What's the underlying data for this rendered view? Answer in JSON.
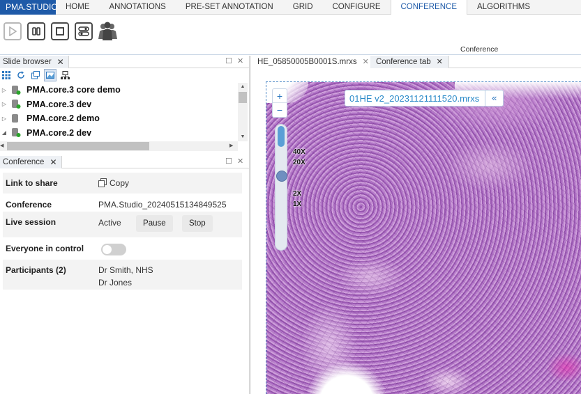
{
  "menu": {
    "brand": "PMA.STUDIO",
    "items": [
      "HOME",
      "ANNOTATIONS",
      "PRE-SET ANNOTATION",
      "GRID",
      "CONFIGURE",
      "CONFERENCE",
      "ALGORITHMS"
    ],
    "active": "CONFERENCE"
  },
  "ribbon": {
    "caption": "Conference",
    "buttons": [
      "play-icon",
      "pause-icon",
      "stop-icon",
      "toggle-settings-icon",
      "participants-icon"
    ]
  },
  "slide_browser": {
    "title": "Slide browser",
    "tools": [
      "grid-icon",
      "refresh-icon",
      "open-window-icon",
      "image-view-icon",
      "network-icon"
    ],
    "tree": [
      {
        "label": "PMA.core.3 core demo",
        "expanded": false,
        "status": "connected"
      },
      {
        "label": "PMA.core.3 dev",
        "expanded": false,
        "status": "connected"
      },
      {
        "label": "PMA.core.2 demo",
        "expanded": false,
        "status": "neutral"
      },
      {
        "label": "PMA.core.2 dev",
        "expanded": true,
        "status": "connected"
      }
    ]
  },
  "conference": {
    "title": "Conference",
    "link_label": "Link to share",
    "copy_label": "Copy",
    "conference_label": "Conference",
    "conference_value": "PMA.Studio_20240515134849525",
    "live_label": "Live session",
    "live_value": "Active",
    "pause_label": "Pause",
    "stop_label": "Stop",
    "control_label": "Everyone in control",
    "control_on": false,
    "participants_label": "Participants (2)",
    "participants": [
      "Dr Smith, NHS",
      "Dr Jones"
    ]
  },
  "viewer": {
    "tabs": [
      "HE_05850005B0001S.mrxs",
      "Conference tab"
    ],
    "active_tab": "Conference tab",
    "slide_name": "01HE v2_20231121111520.mrxs",
    "collapse_label": "«",
    "zoom_in": "+",
    "zoom_out": "−",
    "zoom_levels": [
      "40X",
      "20X",
      "2X",
      "1X"
    ]
  },
  "colors": {
    "brand": "#1e5aa8",
    "accent": "#2a8ac8",
    "tissue": "#b67bc8"
  }
}
